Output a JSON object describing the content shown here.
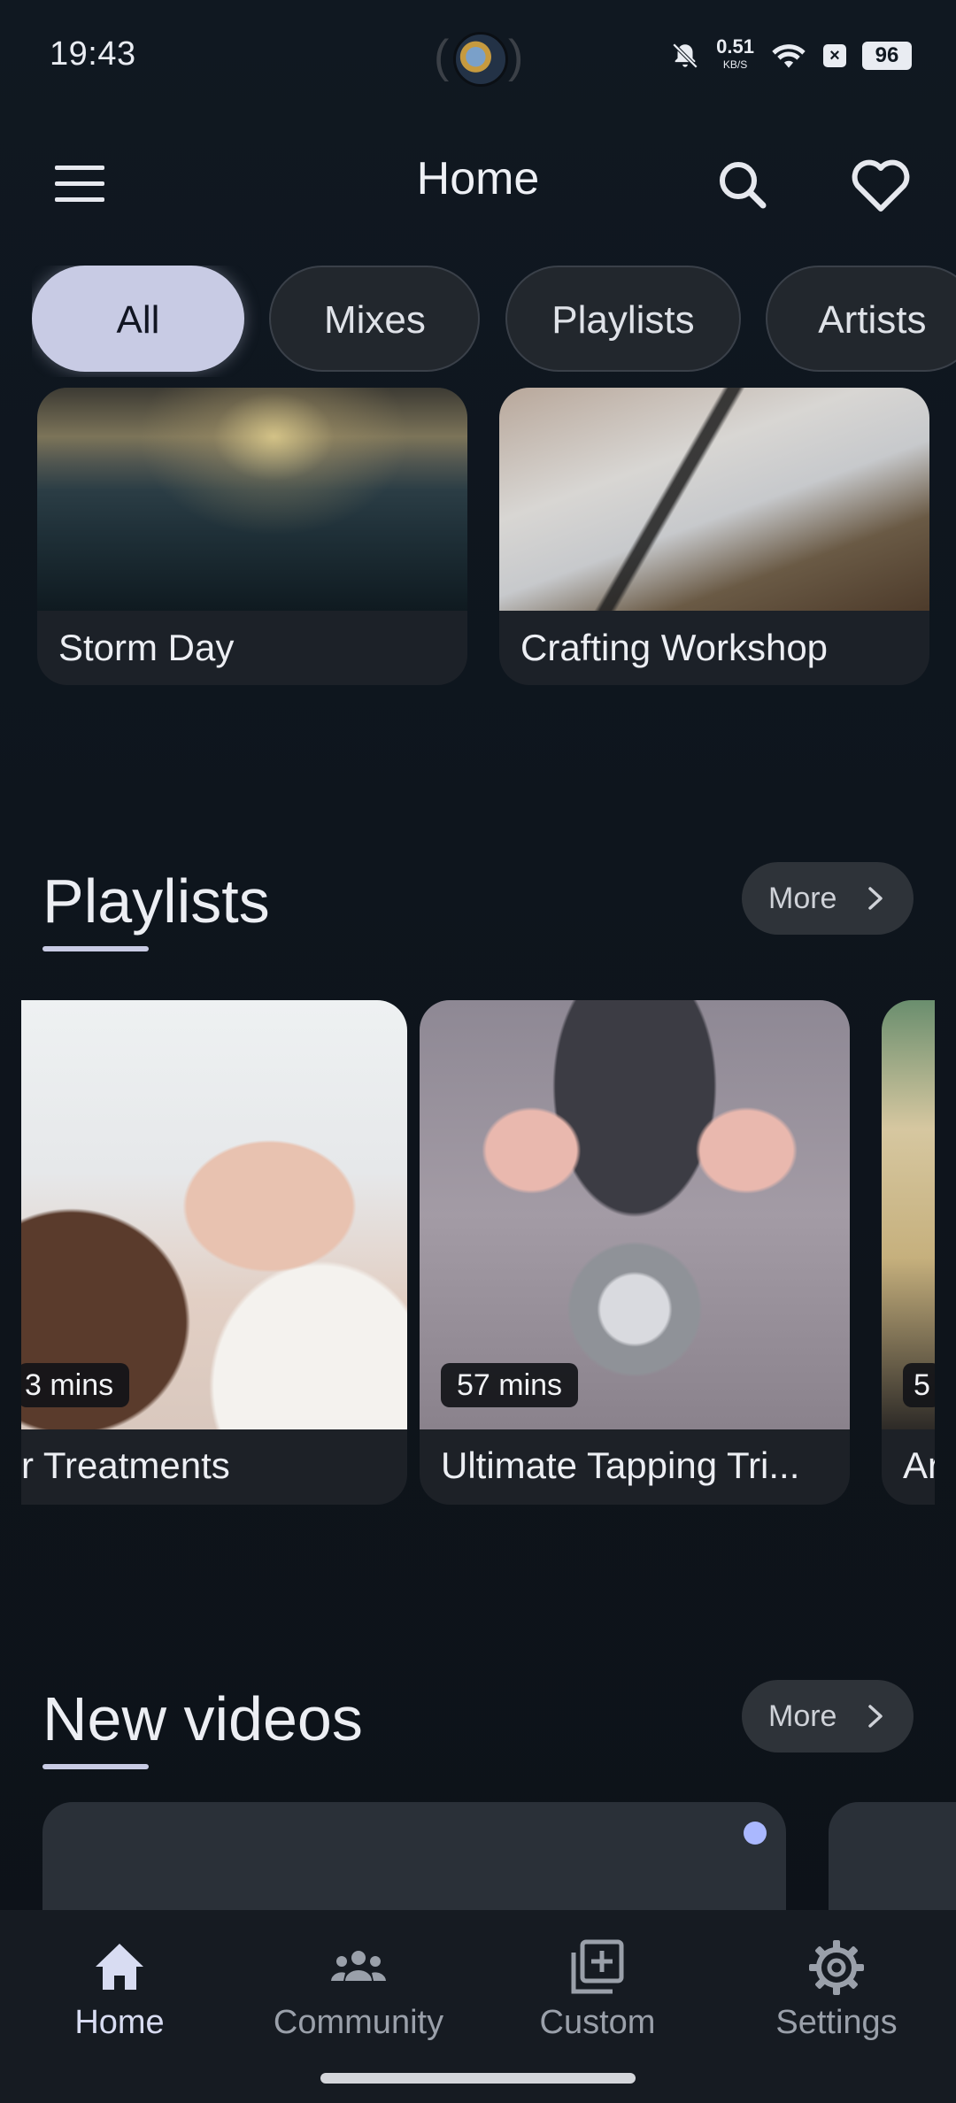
{
  "status_bar": {
    "time": "19:43",
    "net_speed": "0.51",
    "net_unit": "KB/S",
    "battery": "96",
    "icons": [
      "bell-off-icon",
      "wifi-icon",
      "xbox-icon",
      "battery-icon"
    ]
  },
  "app_bar": {
    "title": "Home",
    "icons": [
      "menu-icon",
      "search-icon",
      "heart-icon"
    ]
  },
  "chips": [
    "All",
    "Mixes",
    "Playlists",
    "Artists"
  ],
  "selected_chip": "All",
  "mixes": [
    {
      "label": "Storm Day"
    },
    {
      "label": "Crafting Workshop"
    }
  ],
  "playlists_section": {
    "title": "Playlists",
    "more": "More",
    "items": [
      {
        "label": "r Treatments",
        "duration": "3 mins"
      },
      {
        "label": "Ultimate Tapping Tri...",
        "duration": "57 mins"
      },
      {
        "label": "Ar",
        "duration": "5"
      }
    ]
  },
  "new_videos_section": {
    "title": "New videos",
    "more": "More"
  },
  "bottom_nav": [
    {
      "label": "Home",
      "icon": "home-icon",
      "active": true
    },
    {
      "label": "Community",
      "icon": "community-icon",
      "active": false
    },
    {
      "label": "Custom",
      "icon": "add-box-icon",
      "active": false
    },
    {
      "label": "Settings",
      "icon": "gear-icon",
      "active": false
    }
  ],
  "colors": {
    "background": "#0f1520",
    "accent": "#c8cbe4",
    "card": "#1c2128",
    "unread_dot": "#aab8ff"
  }
}
